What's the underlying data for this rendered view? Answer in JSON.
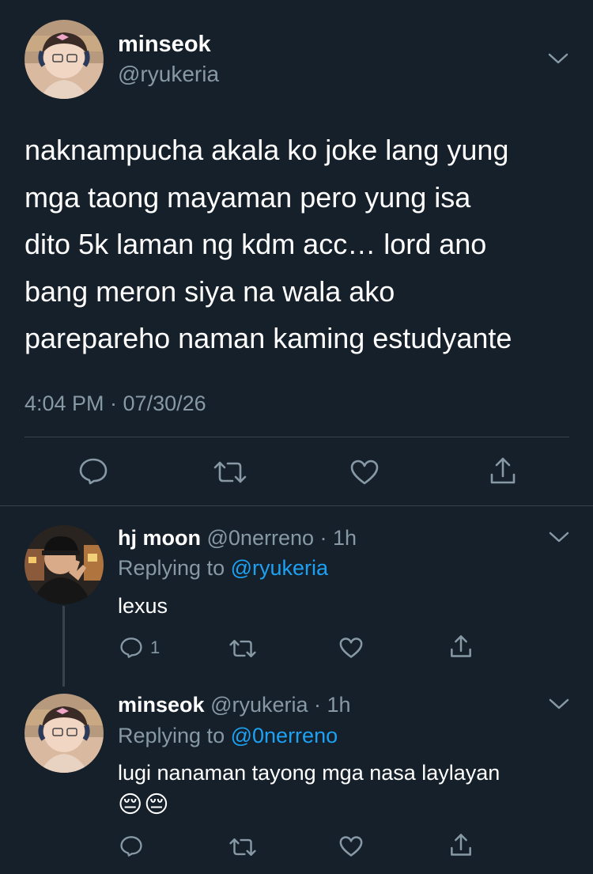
{
  "main_tweet": {
    "display_name": "minseok",
    "handle": "@ryukeria",
    "text_lines": [
      "naknampucha akala ko joke lang yung",
      "mga taong mayaman pero yung isa",
      "dito 5k laman ng kdm acc… lord ano",
      "bang meron siya na wala ako",
      "parepareho naman kaming estudyante"
    ],
    "timestamp": "4:04 PM · 07/30/26"
  },
  "reply1": {
    "display_name": "hj moon",
    "handle_time": "@0nerreno · 1h",
    "replying_prefix": "Replying to",
    "replying_to": "@ryukeria",
    "text": "lexus",
    "reply_count": "1"
  },
  "reply2": {
    "display_name": "minseok",
    "handle_time": "@ryukeria · 1h",
    "replying_prefix": "Replying to",
    "replying_to": "@0nerreno",
    "text": "lugi nanaman tayong mga nasa laylayan",
    "emoji": "😔😔"
  },
  "colors": {
    "background": "#15202b",
    "secondary_text": "#8899a6",
    "link": "#1da1f2",
    "divider": "#38444d"
  },
  "icons": [
    "reply-icon",
    "retweet-icon",
    "like-icon",
    "share-icon",
    "chevron-down-icon"
  ]
}
